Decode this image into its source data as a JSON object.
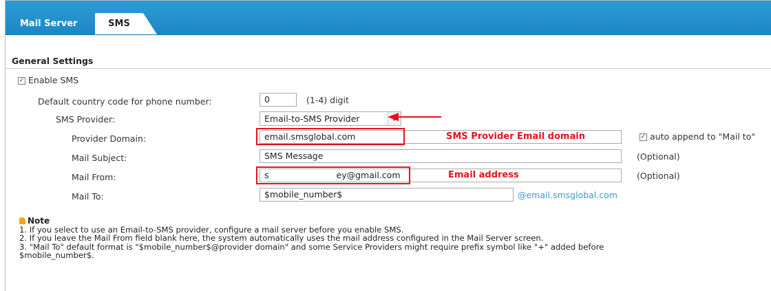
{
  "tabs": {
    "mail_server": "Mail Server",
    "sms": "SMS"
  },
  "section_title": "General Settings",
  "enable_sms": {
    "label": "Enable SMS",
    "checked": true
  },
  "country_code": {
    "label": "Default country code for phone number:",
    "value": "0",
    "hint": "(1-4) digit"
  },
  "provider": {
    "label": "SMS Provider:",
    "value": "Email-to-SMS Provider"
  },
  "provider_domain": {
    "label": "Provider Domain:",
    "value": "email.smsglobal.com"
  },
  "auto_append": {
    "label": "auto append to \"Mail to\"",
    "checked": true
  },
  "mail_subject": {
    "label": "Mail Subject:",
    "value": "SMS Message",
    "hint": "(Optional)"
  },
  "mail_from": {
    "label": "Mail From:",
    "value_prefix": "s",
    "value_suffix": "ey@gmail.com",
    "hint": "(Optional)"
  },
  "mail_to": {
    "label": "Mail To:",
    "value": "$mobile_number$",
    "suffix": "@email.smsglobal.com"
  },
  "annotations": {
    "provider_domain": "SMS Provider Email domain",
    "mail_from": "Email address"
  },
  "note": {
    "title": "Note",
    "lines": [
      "1. If you select to use an Email-to-SMS provider, configure a mail server before you enable SMS.",
      "2. If you leave the Mail From field blank here, the system automatically uses the mail address configured in the Mail Server screen.",
      "3. \"Mail To\" default format is \"$mobile_number$@provider domain\" and some Service Providers might require prefix symbol like \"+\" added before",
      "$mobile_number$."
    ]
  },
  "colors": {
    "tab_bar": "#2d9bd6",
    "annotation_red": "#e4121b",
    "link_blue": "#3b9bc8"
  },
  "icons": {
    "check": "✓",
    "note": "note-icon",
    "arrow": "red-arrow-icon"
  }
}
